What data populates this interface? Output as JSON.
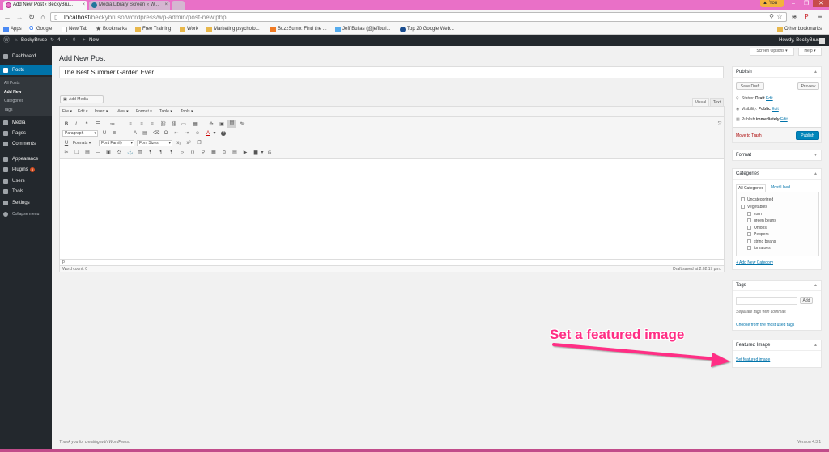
{
  "browser": {
    "tabs": [
      {
        "title": "Add New Post ‹ BeckyBru..."
      },
      {
        "title": "Media Library Screen « W..."
      }
    ],
    "profile": "You",
    "url_host": "localhost",
    "url_path": "/beckybruso/wordpress/wp-admin/post-new.php",
    "bookmarks": [
      "Apps",
      "Google",
      "New Tab",
      "Bookmarks",
      "Free Training",
      "Work",
      "Marketing psycholo...",
      "BuzzSumo: Find the ...",
      "Jeff Bullas (@jeffbull...",
      "Top 20 Google Web..."
    ],
    "other_bookmarks": "Other bookmarks"
  },
  "adminbar": {
    "site": "BeckyBruso",
    "updates": "4",
    "comments": "0",
    "new": "New",
    "howdy": "Howdy, BeckyBruso"
  },
  "sidebar": {
    "items": [
      {
        "label": "Dashboard"
      },
      {
        "label": "Posts"
      },
      {
        "label": "Media"
      },
      {
        "label": "Pages"
      },
      {
        "label": "Comments"
      },
      {
        "label": "Appearance"
      },
      {
        "label": "Plugins",
        "badge": "3"
      },
      {
        "label": "Users"
      },
      {
        "label": "Tools"
      },
      {
        "label": "Settings"
      },
      {
        "label": "Collapse menu"
      }
    ],
    "submenu": [
      "All Posts",
      "Add New",
      "Categories",
      "Tags"
    ]
  },
  "main": {
    "page_title": "Add New Post",
    "screen_options": "Screen Options ▾",
    "help": "Help ▾",
    "post_title": "The Best Summer Garden Ever",
    "add_media": "Add Media",
    "tab_visual": "Visual",
    "tab_text": "Text",
    "menus": [
      "File ▾",
      "Edit ▾",
      "Insert ▾",
      "View ▾",
      "Format ▾",
      "Table ▾",
      "Tools ▾"
    ],
    "paragraph": "Paragraph",
    "formats": "Formats ▾",
    "font_family": "Font Family",
    "font_sizes": "Font Sizes",
    "path": "p",
    "word_count": "Word count: 0",
    "draft_saved": "Draft saved at 2:02:17 pm."
  },
  "publish": {
    "title": "Publish",
    "save_draft": "Save Draft",
    "preview": "Preview",
    "status_label": "Status:",
    "status_value": "Draft",
    "visibility_label": "Visibility:",
    "visibility_value": "Public",
    "publish_label": "Publish",
    "publish_value": "immediately",
    "edit": "Edit",
    "trash": "Move to Trash",
    "publish_button": "Publish"
  },
  "format_box": {
    "title": "Format"
  },
  "categories": {
    "title": "Categories",
    "tab_all": "All Categories",
    "tab_used": "Most Used",
    "items": [
      "Uncategorized",
      "Vegetables",
      "corn",
      "green beans",
      "Onions",
      "Peppers",
      "string beans",
      "tomatoes"
    ],
    "add_new": "+ Add New Category"
  },
  "tags": {
    "title": "Tags",
    "add": "Add",
    "hint": "Separate tags with commas",
    "choose": "Choose from the most used tags"
  },
  "featured": {
    "title": "Featured Image",
    "link": "Set featured image"
  },
  "annotation": {
    "text": "Set a featured image",
    "color": "#ff2e85"
  },
  "footer": {
    "thanks": "Thank you for creating with WordPress.",
    "version": "Version 4.3.1"
  },
  "colors": {
    "accent": "#0073aa",
    "sidebar": "#23282d",
    "chrome": "#e970c7"
  }
}
